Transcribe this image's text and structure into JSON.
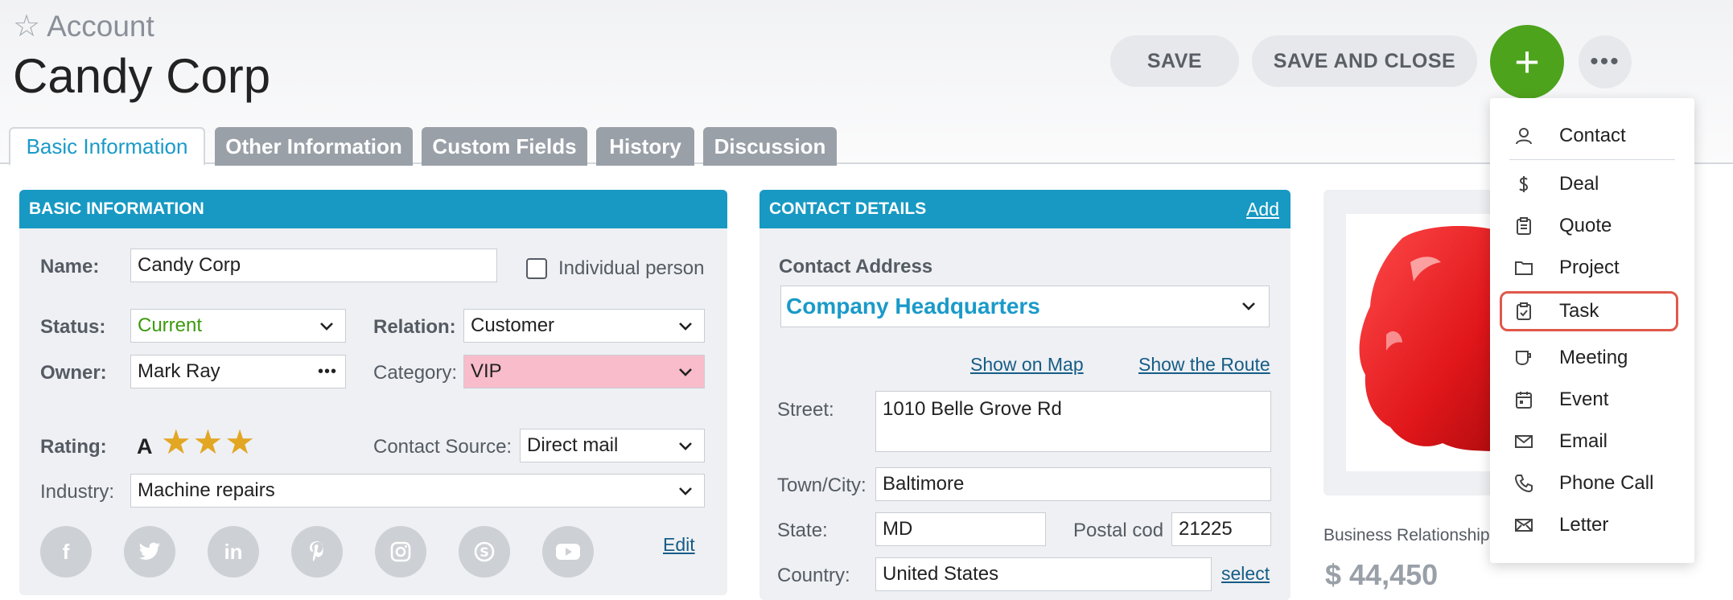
{
  "header": {
    "breadcrumb": "Account",
    "title": "Candy Corp",
    "save_label": "SAVE",
    "save_close_label": "SAVE AND CLOSE",
    "plus_label": "+",
    "more_label": "•••"
  },
  "tabs": [
    {
      "label": "Basic Information"
    },
    {
      "label": "Other Information"
    },
    {
      "label": "Custom Fields"
    },
    {
      "label": "History"
    },
    {
      "label": "Discussion"
    }
  ],
  "basic": {
    "heading": "BASIC INFORMATION",
    "name_label": "Name:",
    "name_value": "Candy Corp",
    "individual_label": "Individual person",
    "status_label": "Status:",
    "status_value": "Current",
    "relation_label": "Relation:",
    "relation_value": "Customer",
    "owner_label": "Owner:",
    "owner_value": "Mark Ray",
    "owner_more": "•••",
    "category_label": "Category:",
    "category_value": "VIP",
    "rating_label": "Rating:",
    "rating_grade": "A",
    "rating_stars": "★★★",
    "source_label": "Contact Source:",
    "source_value": "Direct mail",
    "industry_label": "Industry:",
    "industry_value": "Machine repairs",
    "edit_label": "Edit"
  },
  "contact": {
    "heading": "CONTACT DETAILS",
    "add_label": "Add",
    "address_label": "Contact Address",
    "address_value": "Company Headquarters",
    "show_map": "Show on Map",
    "show_route": "Show the Route",
    "street_label": "Street:",
    "street_value": "1010 Belle Grove Rd",
    "town_label": "Town/City:",
    "town_value": "Baltimore",
    "state_label": "State:",
    "state_value": "MD",
    "postal_label": "Postal cod",
    "postal_value": "21225",
    "country_label": "Country:",
    "country_value": "United States",
    "select_label": "select"
  },
  "side": {
    "biz_label": "Business Relationship",
    "biz_value": "$ 44,450"
  },
  "menu": {
    "items": [
      {
        "label": "Contact",
        "icon": "person-icon"
      },
      {
        "label": "Deal",
        "icon": "dollar-icon"
      },
      {
        "label": "Quote",
        "icon": "clipboard-icon"
      },
      {
        "label": "Project",
        "icon": "folder-icon"
      },
      {
        "label": "Task",
        "icon": "checkbox-clipboard-icon"
      },
      {
        "label": "Meeting",
        "icon": "cup-icon"
      },
      {
        "label": "Event",
        "icon": "calendar-icon"
      },
      {
        "label": "Email",
        "icon": "envelope-icon"
      },
      {
        "label": "Phone Call",
        "icon": "phone-icon"
      },
      {
        "label": "Letter",
        "icon": "letter-icon"
      }
    ]
  },
  "colors": {
    "accent": "#1799c3",
    "plus_button": "#4ea31c",
    "highlight": "#e0584a",
    "category_bg": "#f8bccb",
    "status_text": "#3c9a0e",
    "stars": "#e2a623"
  }
}
